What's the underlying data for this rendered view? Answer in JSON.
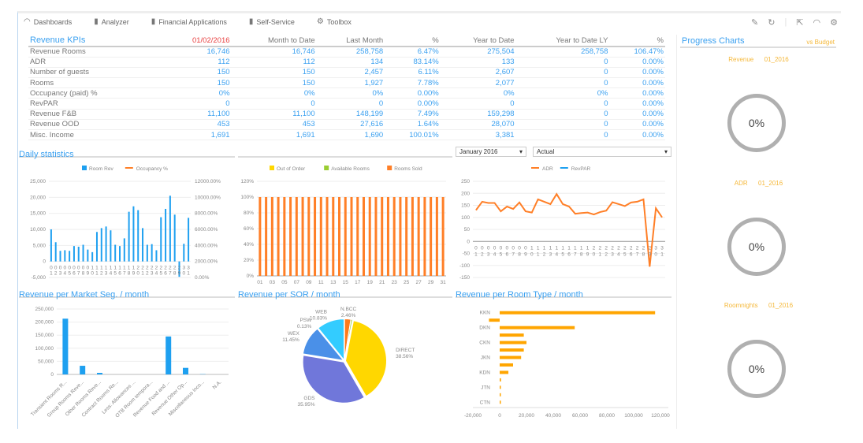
{
  "nav": {
    "items": [
      {
        "label": "Dashboards",
        "icon": "dashboard-icon"
      },
      {
        "label": "Analyzer",
        "icon": "bar-chart-icon"
      },
      {
        "label": "Financial Applications",
        "icon": "bar-chart-icon"
      },
      {
        "label": "Self-Service",
        "icon": "bar-chart-icon"
      },
      {
        "label": "Toolbox",
        "icon": "gears-icon"
      }
    ]
  },
  "toolbar": {
    "icons": [
      "pencil-icon",
      "refresh-icon",
      "export-icon",
      "dashboard-icon",
      "gear-icon"
    ]
  },
  "kpi": {
    "title": "Revenue KPIs",
    "date": "01/02/2016",
    "date_color": "#e84040",
    "columns": [
      "Month to Date",
      "Last Month",
      "%",
      "Year to Date",
      "Year to Date LY",
      "%"
    ],
    "rows": [
      [
        "Revenue Rooms",
        "16,746",
        "16,746",
        "258,758",
        "6.47%",
        "275,504",
        "258,758",
        "106.47%"
      ],
      [
        "ADR",
        "112",
        "112",
        "134",
        "83.14%",
        "133",
        "0",
        "0.00%"
      ],
      [
        "Number of guests",
        "150",
        "150",
        "2,457",
        "6.11%",
        "2,607",
        "0",
        "0.00%"
      ],
      [
        "Rooms",
        "150",
        "150",
        "1,927",
        "7.78%",
        "2,077",
        "0",
        "0.00%"
      ],
      [
        "Occupancy (paid) %",
        "0%",
        "0%",
        "0%",
        "0.00%",
        "0%",
        "0%",
        "0.00%"
      ],
      [
        "RevPAR",
        "0",
        "0",
        "0",
        "0.00%",
        "0",
        "0",
        "0.00%"
      ],
      [
        "Revenue F&B",
        "11,100",
        "11,100",
        "148,199",
        "7.49%",
        "159,298",
        "0",
        "0.00%"
      ],
      [
        "Revenue OOD",
        "453",
        "453",
        "27,616",
        "1.64%",
        "28,070",
        "0",
        "0.00%"
      ],
      [
        "Misc. Income",
        "1,691",
        "1,691",
        "1,690",
        "100.01%",
        "3,381",
        "0",
        "0.00%"
      ]
    ]
  },
  "daily": {
    "title": "Daily statistics"
  },
  "filters": {
    "month": "January 2016",
    "scenario": "Actual"
  },
  "progress": {
    "title": "Progress Charts",
    "subtitle": "vs Budget",
    "gauges": [
      {
        "label": "Revenue",
        "period": "01_2016",
        "value": "0%"
      },
      {
        "label": "ADR",
        "period": "01_2016",
        "value": "0%"
      },
      {
        "label": "Roomnights",
        "period": "01_2016",
        "value": "0%"
      }
    ]
  },
  "sections": {
    "market": "Revenue per Market Seg.  / month",
    "sor": "Revenue per SOR / month",
    "roomtype": "Revenue per Room Type / month"
  },
  "chart_data": [
    {
      "type": "bar",
      "series": [
        {
          "name": "Room Rev",
          "color": "#1ea0f0",
          "values": [
            10000,
            6000,
            3300,
            3500,
            3300,
            4800,
            4600,
            5200,
            3700,
            2900,
            9200,
            10400,
            10900,
            9700,
            5200,
            4800,
            7200,
            15500,
            17200,
            16000,
            10400,
            5200,
            5400,
            3500,
            13800,
            16400,
            20500,
            14600,
            -4800,
            5500,
            13600
          ]
        },
        {
          "name": "Occupancy %",
          "color": "#ff7f27",
          "values": []
        }
      ],
      "categories": [
        "01",
        "02",
        "03",
        "04",
        "05",
        "06",
        "07",
        "08",
        "09",
        "10",
        "11",
        "12",
        "13",
        "14",
        "15",
        "16",
        "17",
        "18",
        "19",
        "20",
        "21",
        "22",
        "23",
        "24",
        "25",
        "26",
        "27",
        "28",
        "29",
        "30",
        "31"
      ],
      "ylim": [
        -5000,
        25000
      ],
      "yticks": [
        "-5,000",
        "0",
        "5,000",
        "10,000",
        "15,000",
        "20,000",
        "25,000"
      ],
      "y2ticks": [
        "0.00%",
        "2000.00%",
        "4000.00%",
        "6000.00%",
        "8000.00%",
        "10000.00%",
        "12000.00%"
      ],
      "grid": true,
      "legend": "top"
    },
    {
      "type": "bar",
      "stacked": true,
      "series": [
        {
          "name": "Out of Order",
          "color": "#ffd700",
          "values": []
        },
        {
          "name": "Available Rooms",
          "color": "#9acd32",
          "values": []
        },
        {
          "name": "Rooms Sold",
          "color": "#ff7f27",
          "values": [
            100,
            100,
            100,
            100,
            100,
            100,
            100,
            100,
            100,
            100,
            100,
            100,
            100,
            100,
            100,
            100,
            100,
            100,
            100,
            100,
            100,
            100,
            100,
            100,
            100,
            100,
            100,
            100,
            100,
            100,
            100
          ]
        }
      ],
      "xticks": [
        "01",
        "03",
        "05",
        "07",
        "09",
        "11",
        "13",
        "15",
        "17",
        "19",
        "21",
        "23",
        "25",
        "27",
        "29",
        "31"
      ],
      "ylim": [
        0,
        120
      ],
      "yticks": [
        "0%",
        "20%",
        "40%",
        "60%",
        "80%",
        "100%",
        "120%"
      ],
      "grid": true,
      "legend": "top"
    },
    {
      "type": "line",
      "series": [
        {
          "name": "ADR",
          "color": "#ff7f27",
          "values": [
            130,
            165,
            160,
            160,
            125,
            145,
            135,
            162,
            125,
            120,
            175,
            165,
            155,
            197,
            155,
            145,
            115,
            118,
            120,
            112,
            122,
            128,
            163,
            155,
            147,
            162,
            165,
            175,
            -105,
            138,
            100
          ]
        },
        {
          "name": "RevPAR",
          "color": "#1ea0f0",
          "values": []
        }
      ],
      "categories": [
        "01",
        "02",
        "03",
        "04",
        "05",
        "06",
        "07",
        "08",
        "09",
        "10",
        "11",
        "12",
        "13",
        "14",
        "15",
        "16",
        "17",
        "18",
        "19",
        "20",
        "21",
        "22",
        "23",
        "24",
        "25",
        "26",
        "27",
        "28",
        "29",
        "30",
        "31"
      ],
      "ylim": [
        -150,
        250
      ],
      "yticks": [
        "-150",
        "-100",
        "-50",
        "0",
        "50",
        "100",
        "150",
        "200",
        "250"
      ],
      "grid": true,
      "legend": "top"
    },
    {
      "type": "bar",
      "categories": [
        "Transient Rooms R...",
        "Group Rooms Reve...",
        "Other Rooms Reve...",
        "Contract Rooms Re...",
        "Less: Allowances ...",
        "OTB Room tempora...",
        "Revenue Food and ...",
        "Revenue Other Op...",
        "Miscellaneous Inco...",
        "N.A."
      ],
      "values": [
        213000,
        33000,
        6000,
        0,
        0,
        0,
        145000,
        25000,
        1000,
        0
      ],
      "color": "#1ea0f0",
      "ylim": [
        0,
        250000
      ],
      "yticks": [
        "0",
        "50,000",
        "100,000",
        "150,000",
        "200,000",
        "250,000"
      ]
    },
    {
      "type": "pie",
      "slices": [
        {
          "name": "N.BCC",
          "label": "2.46%",
          "value": 2.46,
          "color": "#ff7a1a"
        },
        {
          "name": "",
          "label": "",
          "value": 0.62,
          "color": "#9acd32"
        },
        {
          "name": "DIRECT",
          "label": "38.56%",
          "value": 38.56,
          "color": "#ffd700"
        },
        {
          "name": "GDS",
          "label": "35.95%",
          "value": 35.95,
          "color": "#7077da"
        },
        {
          "name": "WEX",
          "label": "11.45%",
          "value": 11.45,
          "color": "#4a90e8"
        },
        {
          "name": "PSW",
          "label": "0.13%",
          "value": 0.13,
          "color": "#8888cc"
        },
        {
          "name": "WEB",
          "label": "10.83%",
          "value": 10.83,
          "color": "#33ccff"
        }
      ]
    },
    {
      "type": "bar",
      "orientation": "horizontal",
      "categories": [
        "KKN",
        "",
        "DKN",
        "",
        "CKN",
        "",
        "JKN",
        "",
        "KDN",
        "",
        "JTN",
        "",
        "CTN"
      ],
      "values": [
        116000,
        -8000,
        56000,
        18000,
        20000,
        18000,
        16000,
        10000,
        6500,
        1000,
        800,
        300,
        800
      ],
      "color": "#ffa500",
      "xlim": [
        -20000,
        120000
      ],
      "xticks": [
        "-20,000",
        "0",
        "20,000",
        "40,000",
        "60,000",
        "80,000",
        "100,000",
        "120,000"
      ]
    }
  ]
}
